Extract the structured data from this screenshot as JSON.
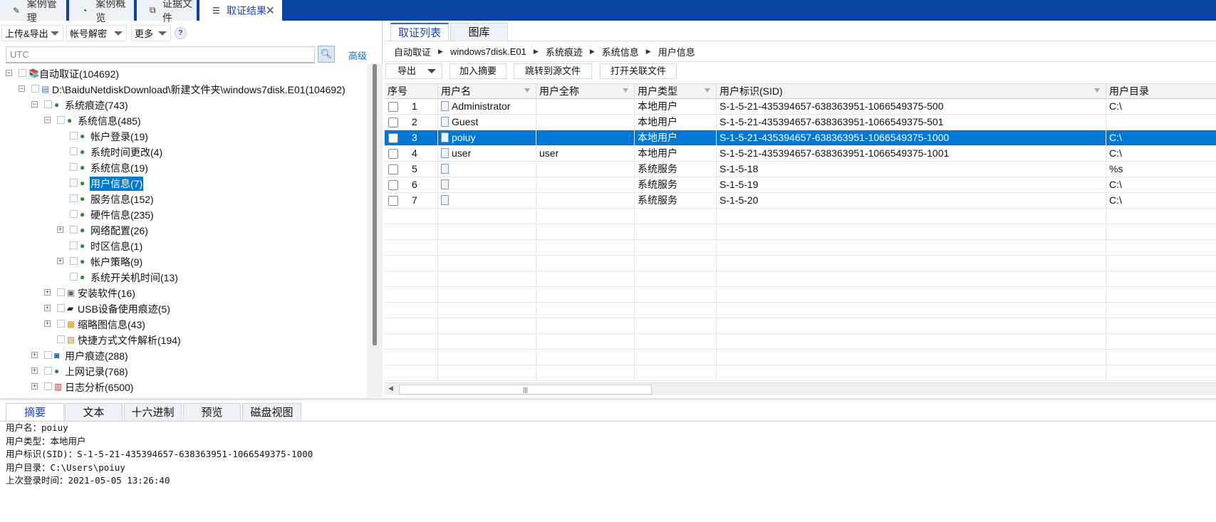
{
  "top_tabs": [
    {
      "label": "案例管理",
      "icon": "edit-icon"
    },
    {
      "label": "案例概览",
      "icon": "pie-chart-icon"
    },
    {
      "label": "证据文件",
      "icon": "files-icon"
    },
    {
      "label": "取证结果",
      "icon": "result-icon",
      "active": true
    }
  ],
  "left": {
    "toolbar": {
      "upload_export": "上传&导出",
      "account_decrypt": "帐号解密",
      "more": "更多",
      "help": "?"
    },
    "search": {
      "value": "UTC",
      "advanced": "高级"
    },
    "tree": [
      {
        "label": "自动取证(104692)",
        "level": 0,
        "exp": "-",
        "icon": "archive"
      },
      {
        "label": "D:\\BaiduNetdiskDownload\\新建文件夹\\windows7disk.E01(104692)",
        "level": 1,
        "exp": "-",
        "icon": "doc"
      },
      {
        "label": "系统痕迹(743)",
        "level": 2,
        "exp": "-",
        "icon": "globe"
      },
      {
        "label": "系统信息(485)",
        "level": 3,
        "exp": "-",
        "icon": "globe"
      },
      {
        "label": "帐户登录(19)",
        "level": 4,
        "exp": "",
        "icon": "globe"
      },
      {
        "label": "系统时间更改(4)",
        "level": 4,
        "exp": "",
        "icon": "globe"
      },
      {
        "label": "系统信息(19)",
        "level": 4,
        "exp": "",
        "icon": "globe"
      },
      {
        "label": "用户信息(7)",
        "level": 4,
        "exp": "",
        "icon": "globe",
        "selected": true
      },
      {
        "label": "服务信息(152)",
        "level": 4,
        "exp": "",
        "icon": "globe"
      },
      {
        "label": "硬件信息(235)",
        "level": 4,
        "exp": "",
        "icon": "globe"
      },
      {
        "label": "网络配置(26)",
        "level": 4,
        "exp": "+",
        "icon": "globe"
      },
      {
        "label": "时区信息(1)",
        "level": 4,
        "exp": "",
        "icon": "globe"
      },
      {
        "label": "帐户策略(9)",
        "level": 4,
        "exp": "+",
        "icon": "globe"
      },
      {
        "label": "系统开关机时间(13)",
        "level": 4,
        "exp": "",
        "icon": "globe"
      },
      {
        "label": "安装软件(16)",
        "level": 3,
        "exp": "+",
        "icon": "install"
      },
      {
        "label": "USB设备使用痕迹(5)",
        "level": 3,
        "exp": "+",
        "icon": "usb"
      },
      {
        "label": "缩略图信息(43)",
        "level": 3,
        "exp": "+",
        "icon": "image"
      },
      {
        "label": "快捷方式文件解析(194)",
        "level": 3,
        "exp": "",
        "icon": "shortcut"
      },
      {
        "label": "用户痕迹(288)",
        "level": 2,
        "exp": "+",
        "icon": "user"
      },
      {
        "label": "上网记录(768)",
        "level": 2,
        "exp": "+",
        "icon": "globe"
      },
      {
        "label": "日志分析(6500)",
        "level": 2,
        "exp": "+",
        "icon": "log"
      }
    ]
  },
  "right": {
    "tabs": [
      "取证列表",
      "图库"
    ],
    "breadcrumb": [
      "自动取证",
      "windows7disk.E01",
      "系统痕迹",
      "系统信息",
      "用户信息"
    ],
    "toolbar": {
      "export": "导出",
      "add_summary": "加入摘要",
      "jump_source": "跳转到源文件",
      "open_related": "打开关联文件"
    },
    "columns": [
      "序号",
      "用户名",
      "用户全称",
      "用户类型",
      "用户标识(SID)",
      "用户目录"
    ],
    "rows": [
      [
        "1",
        "Administrator",
        "",
        "本地用户",
        "S-1-5-21-435394657-638363951-1066549375-500",
        "C:\\"
      ],
      [
        "2",
        "Guest",
        "",
        "本地用户",
        "S-1-5-21-435394657-638363951-1066549375-501",
        ""
      ],
      [
        "3",
        "poiuy",
        "",
        "本地用户",
        "S-1-5-21-435394657-638363951-1066549375-1000",
        "C:\\"
      ],
      [
        "4",
        "user",
        "user",
        "本地用户",
        "S-1-5-21-435394657-638363951-1066549375-1001",
        "C:\\"
      ],
      [
        "5",
        "",
        "",
        "系统服务",
        "S-1-5-18",
        "%s"
      ],
      [
        "6",
        "",
        "",
        "系统服务",
        "S-1-5-19",
        "C:\\"
      ],
      [
        "7",
        "",
        "",
        "系统服务",
        "S-1-5-20",
        "C:\\"
      ]
    ],
    "selected_row": 2,
    "hscroll_grip": "|||"
  },
  "bottom": {
    "tabs": [
      "摘要",
      "文本",
      "十六进制",
      "预览",
      "磁盘视图"
    ],
    "summary": [
      "用户名：poiuy",
      "用户类型：本地用户",
      "用户标识(SID)：S-1-5-21-435394657-638363951-1066549375-1000",
      "用户目录：C:\\Users\\poiuy",
      "上次登录时间：2021-05-05 13:26:40"
    ]
  }
}
